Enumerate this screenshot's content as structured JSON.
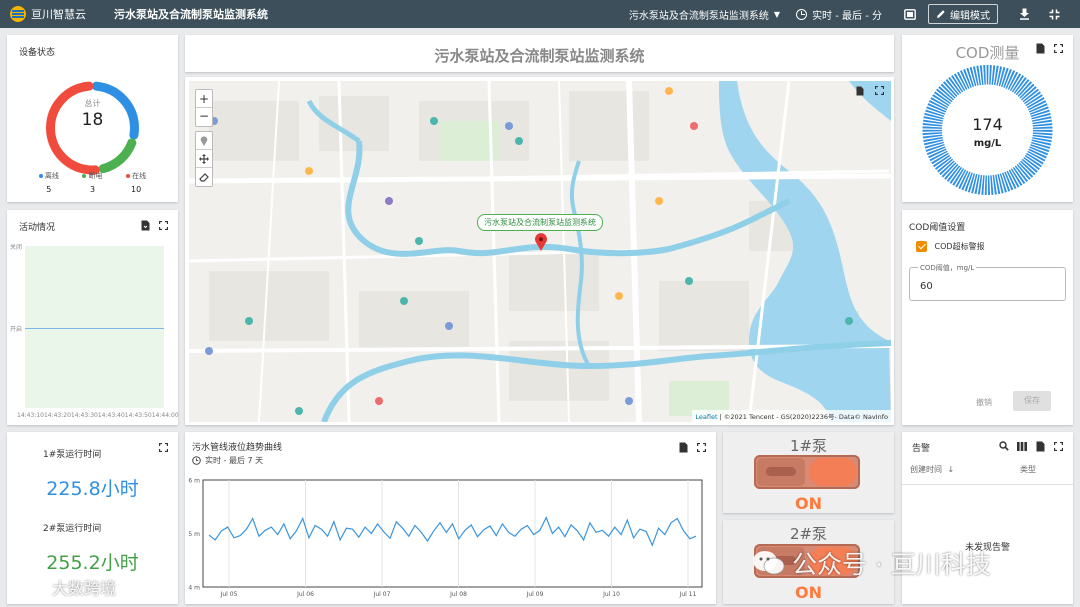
{
  "topbar": {
    "brand": "亘川智慧云",
    "app_title": "污水泵站及合流制泵站监测系统",
    "dashboard_select": "污水泵站及合流制泵站监测系统",
    "time_selector": "实时 - 最后 - 分",
    "edit_mode": "编辑模式"
  },
  "device_status": {
    "title": "设备状态",
    "total_label": "总计",
    "total": "18",
    "offline_label": "离线",
    "offline": "5",
    "poweroff_label": "断电",
    "poweroff": "3",
    "online_label": "在线",
    "online": "10",
    "colors": {
      "offline": "#2f8fe3",
      "poweroff": "#4caf50",
      "online": "#f04c3e"
    }
  },
  "activity": {
    "title": "活动情况",
    "y_close": "关闭",
    "y_open": "开启",
    "x_ticks": "14:43:1014:43:2014:43:3014:43:4014:43:5014:44:00"
  },
  "header_card": {
    "title": "污水泵站及合流制泵站监测系统"
  },
  "map": {
    "marker_label": "污水泵站及合流制泵站监测系统",
    "attribution_leaflet": "Leaflet",
    "attribution": "| ©2021 Tencent - GS(2020)2236号- Data© NavInfo"
  },
  "cod_gauge": {
    "title": "COD测量",
    "value": "174",
    "unit": "mg/L",
    "color": "#2f8fe3"
  },
  "cod_settings": {
    "title": "COD阈值设置",
    "alarm_label": "COD超标警报",
    "threshold_label": "COD阈值，mg/L",
    "threshold_value": "60",
    "cancel": "撤销",
    "save": "保存"
  },
  "pump_runtime": {
    "pump1_label": "1#泵运行时间",
    "pump1_value": "225.8小时",
    "pump2_label": "2#泵运行时间",
    "pump2_value": "255.2小时"
  },
  "level_chart": {
    "title": "污水管线液位趋势曲线",
    "time_window": "实时 - 最后 7 天",
    "y_ticks": [
      "6 m",
      "5 m",
      "4 m"
    ],
    "x_ticks": [
      "Jul 05",
      "Jul 06",
      "Jul 07",
      "Jul 08",
      "Jul 09",
      "Jul 10",
      "Jul 11"
    ]
  },
  "chart_data": {
    "type": "line",
    "title": "污水管线液位趋势曲线",
    "ylim": [
      4,
      6
    ],
    "x_ticks": [
      "Jul 05",
      "Jul 06",
      "Jul 07",
      "Jul 08",
      "Jul 09",
      "Jul 10",
      "Jul 11"
    ],
    "series": [
      {
        "values": [
          4.97,
          4.88,
          5.05,
          5.12,
          4.92,
          4.96,
          5.08,
          5.28,
          4.95,
          5.06,
          5.12,
          4.98,
          5.18,
          4.9,
          5.05,
          5.28,
          4.92,
          5.15,
          5.08,
          4.95,
          5.22,
          4.88,
          5.1,
          5.08,
          4.93,
          5.12,
          5.0,
          5.18,
          5.03,
          4.91,
          5.22,
          5.1,
          4.95,
          5.15,
          5.02,
          4.86,
          5.05,
          5.2,
          5.02,
          5.18,
          4.9,
          5.06,
          5.16,
          4.94,
          5.07,
          5.14,
          4.96,
          5.18,
          5.02,
          4.95,
          5.08,
          5.15,
          4.98,
          5.06,
          5.3,
          5.0,
          5.12,
          4.94,
          5.16,
          5.05,
          4.88,
          5.2,
          5.02,
          5.06,
          4.95,
          5.12,
          4.98,
          5.25,
          4.92,
          5.08,
          5.04,
          4.78,
          5.1,
          4.98,
          5.2,
          5.28,
          5.05,
          4.9,
          4.95
        ]
      }
    ]
  },
  "pump1": {
    "title": "1#泵",
    "state": "ON"
  },
  "pump2": {
    "title": "2#泵",
    "state": "ON"
  },
  "alarms": {
    "title": "告警",
    "col_time": "创建时间",
    "col_type": "类型",
    "empty": "未发现告警"
  },
  "watermarks": {
    "left": "大数跨境",
    "right_a": "公众号",
    "right_b": "· 亘川科技"
  }
}
